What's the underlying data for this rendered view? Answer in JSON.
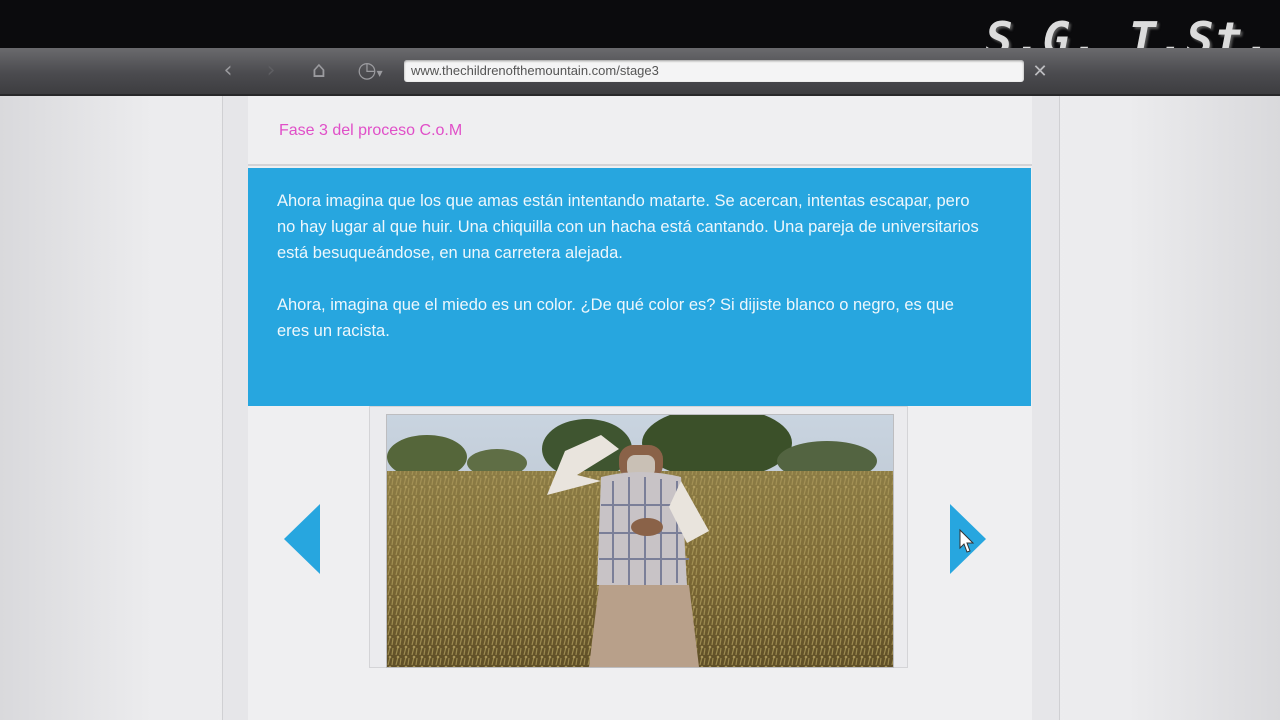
{
  "browser": {
    "url": "www.thechildrenofthemountain.com/stage3",
    "back_icon": "‹",
    "forward_icon": "›",
    "home_icon": "⌂",
    "history_icon": "◷",
    "close_icon": "✕"
  },
  "watermark": "S.G. T.St.",
  "page": {
    "stage_title": "Fase 3 del proceso C.o.M",
    "paragraphs": [
      "Ahora imagina que los que amas están intentando matarte. Se acercan, intentas escapar, pero no hay lugar al que huir. Una chiquilla con un hacha está cantando. Una pareja de universitarios está besuqueándose, en una carretera alejada.",
      "Ahora, imagina que el miedo es un color. ¿De qué color es? Si dijiste blanco o negro, es que eres un racista."
    ]
  },
  "colors": {
    "accent": "#27a6df",
    "title_pink": "#e04fc8"
  }
}
